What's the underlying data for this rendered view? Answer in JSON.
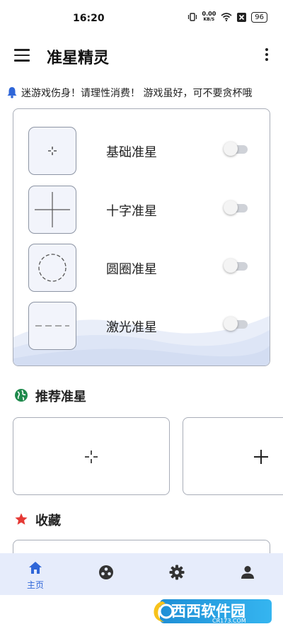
{
  "status_bar": {
    "time": "16:20",
    "net_speed_value": "0.00",
    "net_speed_unit": "KB/S",
    "battery": "96"
  },
  "app_bar": {
    "title": "准星精灵",
    "menu_icon": "hamburger-menu-icon",
    "more_icon": "more-vertical-icon"
  },
  "notice": {
    "icon": "bell-icon",
    "text": "迷游戏伤身！请理性消费！ 游戏虽好，可不要贪杯哦"
  },
  "crosshairs": [
    {
      "label": "基础准星",
      "icon": "basic-crosshair-icon",
      "enabled": false
    },
    {
      "label": "十字准星",
      "icon": "cross-crosshair-icon",
      "enabled": false
    },
    {
      "label": "圆圈准星",
      "icon": "circle-crosshair-icon",
      "enabled": false
    },
    {
      "label": "激光准星",
      "icon": "laser-crosshair-icon",
      "enabled": false
    }
  ],
  "recommended": {
    "title": "推荐准星",
    "icon": "globe-icon"
  },
  "favorites": {
    "title": "收藏",
    "icon": "star-icon"
  },
  "bottom_nav": {
    "items": [
      {
        "label": "主页",
        "icon": "home-icon",
        "active": true
      },
      {
        "label": "",
        "icon": "game-controller-icon",
        "active": false
      },
      {
        "label": "",
        "icon": "settings-gear-icon",
        "active": false
      },
      {
        "label": "",
        "icon": "user-icon",
        "active": false
      }
    ]
  },
  "watermark": {
    "name": "西西软件园",
    "site": "CR173.COM"
  },
  "colors": {
    "accent": "#2f66d8",
    "nav_background": "#e6ecfb",
    "star": "#e53935",
    "globe": "#1f8a4c",
    "bell": "#2f66d8"
  }
}
